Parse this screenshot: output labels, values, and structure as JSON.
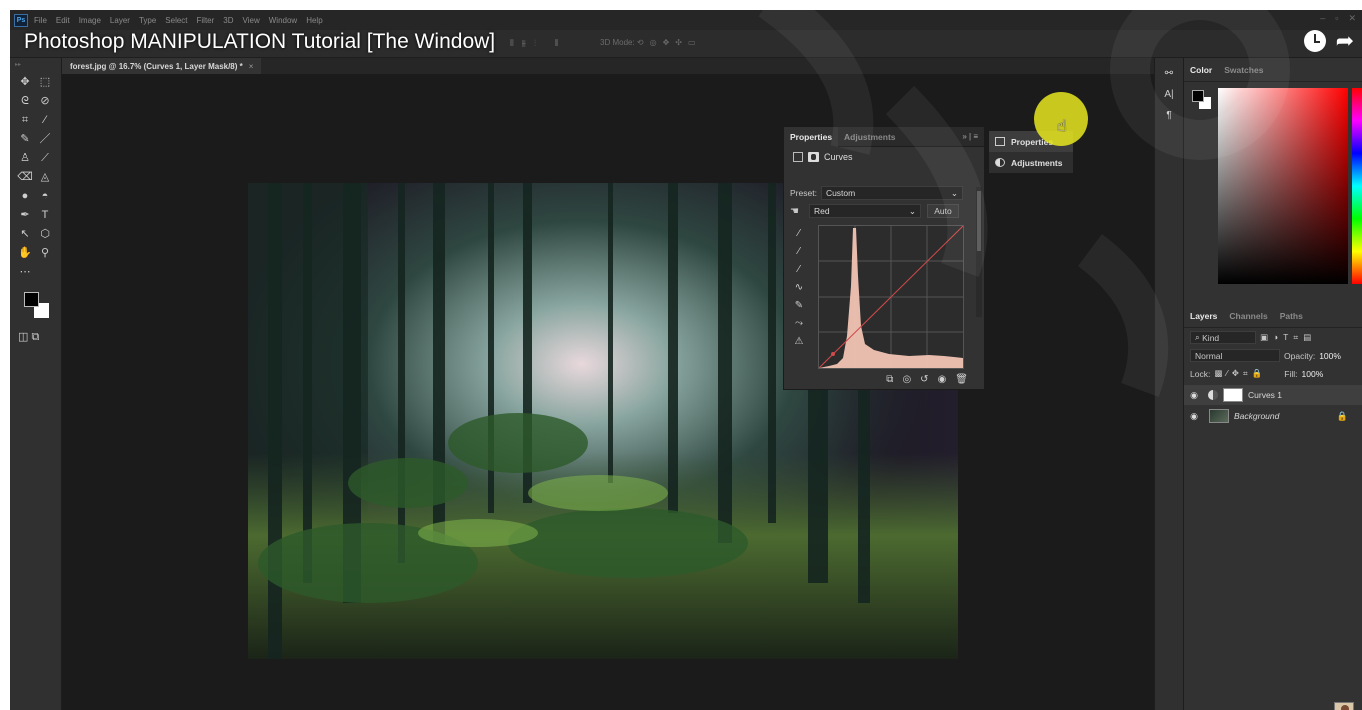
{
  "video": {
    "title": "Photoshop MANIPULATION Tutorial [The Window]"
  },
  "menubar": {
    "app_icon": "Ps",
    "items": [
      "File",
      "Edit",
      "Image",
      "Layer",
      "Type",
      "Select",
      "Filter",
      "3D",
      "View",
      "Window",
      "Help"
    ]
  },
  "options_bar": {
    "mode_3d_label": "3D Mode:"
  },
  "document": {
    "tab_label": "forest.jpg @ 16.7% (Curves 1, Layer Mask/8) *",
    "close_glyph": "×"
  },
  "properties_panel": {
    "tabs": [
      "Properties",
      "Adjustments"
    ],
    "header": "Curves",
    "preset_label": "Preset:",
    "preset_value": "Custom",
    "channel_value": "Red",
    "auto_label": "Auto",
    "histogram_color": "#f2c4b4",
    "curve_color": "#d24a4a"
  },
  "panel_menu": {
    "items": [
      "Properties",
      "Adjustments"
    ]
  },
  "color_panel": {
    "tabs": [
      "Color",
      "Swatches"
    ]
  },
  "layers_panel": {
    "tabs": [
      "Layers",
      "Channels",
      "Paths"
    ],
    "kind_label": "Kind",
    "blend_mode": "Normal",
    "opacity_label": "Opacity:",
    "opacity_value": "100%",
    "lock_label": "Lock:",
    "fill_label": "Fill:",
    "fill_value": "100%",
    "layers": [
      {
        "name": "Curves 1"
      },
      {
        "name": "Background"
      }
    ]
  },
  "colors": {
    "cursor_highlight": "#e8e61e",
    "accent_red": "#d24a4a"
  }
}
